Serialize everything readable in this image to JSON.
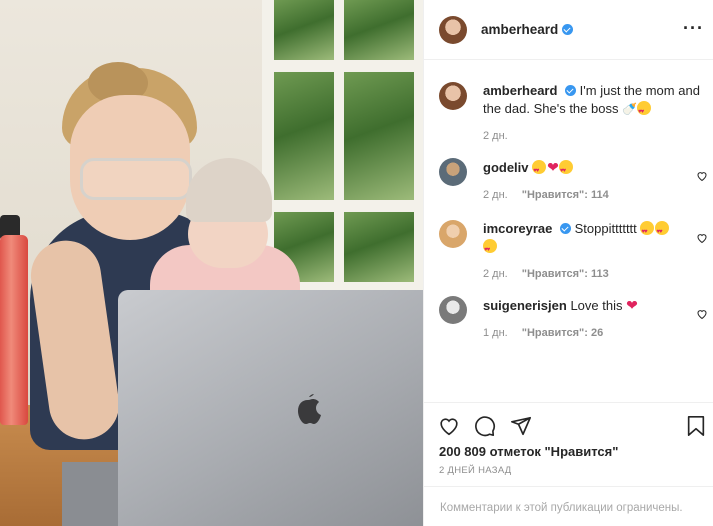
{
  "post": {
    "author": "amberheard",
    "caption": "I'm just the mom and the dad. She's the boss",
    "caption_emojis": [
      "baby-bottle",
      "heart-face"
    ],
    "caption_time": "2 дн."
  },
  "comments": [
    {
      "user": "godeliv",
      "text": "",
      "emojis": [
        "heart-eyes",
        "red-heart",
        "heart-eyes"
      ],
      "time": "2 дн.",
      "likes": "\"Нравится\": 114",
      "verified": false
    },
    {
      "user": "imcoreyrae",
      "text": "Stoppittttttt",
      "emojis": [
        "heart-eyes",
        "heart-eyes",
        "heart-eyes"
      ],
      "time": "2 дн.",
      "likes": "\"Нравится\": 113",
      "verified": true
    },
    {
      "user": "suigenerisjen",
      "text": "Love this",
      "emojis": [
        "red-heart"
      ],
      "time": "1 дн.",
      "likes": "\"Нравится\": 26",
      "verified": false
    }
  ],
  "stats": {
    "likes": "200 809 отметок \"Нравится\"",
    "date": "2 ДНЕЙ НАЗАД"
  },
  "footer": {
    "notice": "Комментарии к этой публикации ограничены."
  },
  "colors": {
    "verified": "#3897f0",
    "heart": "#e0245e",
    "meta": "#8e8e8e"
  }
}
